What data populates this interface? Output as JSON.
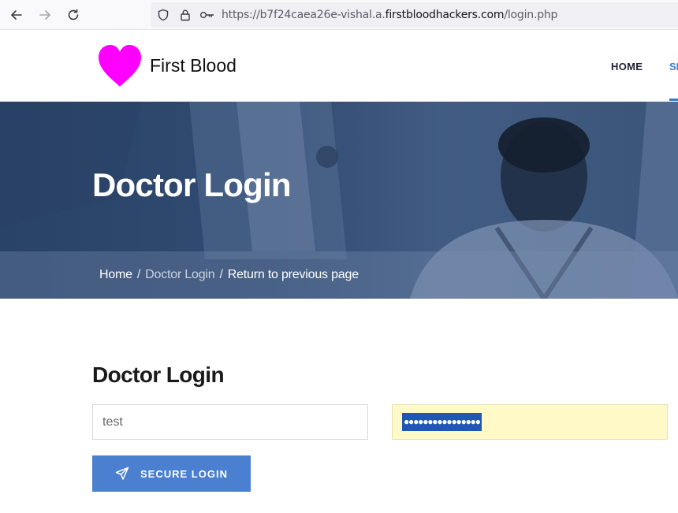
{
  "browser": {
    "url_prefix": "https://b7f24caea26e-vishal.a.",
    "url_domain": "firstbloodhackers.com",
    "url_path": "/login.php",
    "icons": [
      "back-arrow-icon",
      "forward-arrow-icon",
      "reload-icon",
      "shield-icon",
      "lock-icon",
      "key-icon"
    ]
  },
  "header": {
    "brand": "First Blood",
    "logo_icon": "heart-icon",
    "logo_color": "#ff00ff",
    "menu": [
      {
        "label": "HOME"
      },
      {
        "label": "SE",
        "active": true
      }
    ],
    "accent_color": "#3d7cc9"
  },
  "hero": {
    "title": "Doctor Login",
    "breadcrumb": [
      {
        "label": "Home"
      },
      {
        "label": "Doctor Login",
        "current": true
      },
      {
        "label": "Return to previous page"
      }
    ],
    "separator": "/"
  },
  "login": {
    "title": "Doctor Login",
    "username_value": "test",
    "password_value": "●●●●●●●●●●●●●●●●",
    "button_label": "SECURE LOGIN",
    "button_icon": "paper-plane-icon",
    "button_color": "#4a80cf"
  }
}
